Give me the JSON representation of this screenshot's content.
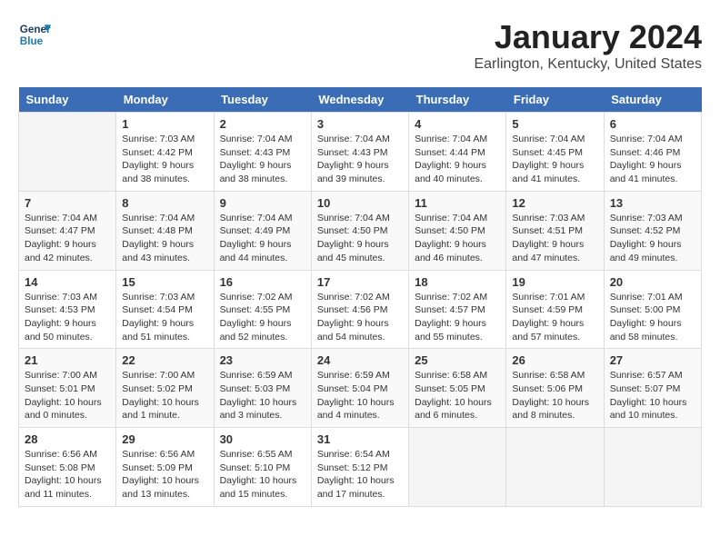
{
  "logo": {
    "line1": "General",
    "line2": "Blue"
  },
  "title": "January 2024",
  "subtitle": "Earlington, Kentucky, United States",
  "days_of_week": [
    "Sunday",
    "Monday",
    "Tuesday",
    "Wednesday",
    "Thursday",
    "Friday",
    "Saturday"
  ],
  "weeks": [
    [
      {
        "num": "",
        "info": ""
      },
      {
        "num": "1",
        "info": "Sunrise: 7:03 AM\nSunset: 4:42 PM\nDaylight: 9 hours\nand 38 minutes."
      },
      {
        "num": "2",
        "info": "Sunrise: 7:04 AM\nSunset: 4:43 PM\nDaylight: 9 hours\nand 38 minutes."
      },
      {
        "num": "3",
        "info": "Sunrise: 7:04 AM\nSunset: 4:43 PM\nDaylight: 9 hours\nand 39 minutes."
      },
      {
        "num": "4",
        "info": "Sunrise: 7:04 AM\nSunset: 4:44 PM\nDaylight: 9 hours\nand 40 minutes."
      },
      {
        "num": "5",
        "info": "Sunrise: 7:04 AM\nSunset: 4:45 PM\nDaylight: 9 hours\nand 41 minutes."
      },
      {
        "num": "6",
        "info": "Sunrise: 7:04 AM\nSunset: 4:46 PM\nDaylight: 9 hours\nand 41 minutes."
      }
    ],
    [
      {
        "num": "7",
        "info": "Sunrise: 7:04 AM\nSunset: 4:47 PM\nDaylight: 9 hours\nand 42 minutes."
      },
      {
        "num": "8",
        "info": "Sunrise: 7:04 AM\nSunset: 4:48 PM\nDaylight: 9 hours\nand 43 minutes."
      },
      {
        "num": "9",
        "info": "Sunrise: 7:04 AM\nSunset: 4:49 PM\nDaylight: 9 hours\nand 44 minutes."
      },
      {
        "num": "10",
        "info": "Sunrise: 7:04 AM\nSunset: 4:50 PM\nDaylight: 9 hours\nand 45 minutes."
      },
      {
        "num": "11",
        "info": "Sunrise: 7:04 AM\nSunset: 4:50 PM\nDaylight: 9 hours\nand 46 minutes."
      },
      {
        "num": "12",
        "info": "Sunrise: 7:03 AM\nSunset: 4:51 PM\nDaylight: 9 hours\nand 47 minutes."
      },
      {
        "num": "13",
        "info": "Sunrise: 7:03 AM\nSunset: 4:52 PM\nDaylight: 9 hours\nand 49 minutes."
      }
    ],
    [
      {
        "num": "14",
        "info": "Sunrise: 7:03 AM\nSunset: 4:53 PM\nDaylight: 9 hours\nand 50 minutes."
      },
      {
        "num": "15",
        "info": "Sunrise: 7:03 AM\nSunset: 4:54 PM\nDaylight: 9 hours\nand 51 minutes."
      },
      {
        "num": "16",
        "info": "Sunrise: 7:02 AM\nSunset: 4:55 PM\nDaylight: 9 hours\nand 52 minutes."
      },
      {
        "num": "17",
        "info": "Sunrise: 7:02 AM\nSunset: 4:56 PM\nDaylight: 9 hours\nand 54 minutes."
      },
      {
        "num": "18",
        "info": "Sunrise: 7:02 AM\nSunset: 4:57 PM\nDaylight: 9 hours\nand 55 minutes."
      },
      {
        "num": "19",
        "info": "Sunrise: 7:01 AM\nSunset: 4:59 PM\nDaylight: 9 hours\nand 57 minutes."
      },
      {
        "num": "20",
        "info": "Sunrise: 7:01 AM\nSunset: 5:00 PM\nDaylight: 9 hours\nand 58 minutes."
      }
    ],
    [
      {
        "num": "21",
        "info": "Sunrise: 7:00 AM\nSunset: 5:01 PM\nDaylight: 10 hours\nand 0 minutes."
      },
      {
        "num": "22",
        "info": "Sunrise: 7:00 AM\nSunset: 5:02 PM\nDaylight: 10 hours\nand 1 minute."
      },
      {
        "num": "23",
        "info": "Sunrise: 6:59 AM\nSunset: 5:03 PM\nDaylight: 10 hours\nand 3 minutes."
      },
      {
        "num": "24",
        "info": "Sunrise: 6:59 AM\nSunset: 5:04 PM\nDaylight: 10 hours\nand 4 minutes."
      },
      {
        "num": "25",
        "info": "Sunrise: 6:58 AM\nSunset: 5:05 PM\nDaylight: 10 hours\nand 6 minutes."
      },
      {
        "num": "26",
        "info": "Sunrise: 6:58 AM\nSunset: 5:06 PM\nDaylight: 10 hours\nand 8 minutes."
      },
      {
        "num": "27",
        "info": "Sunrise: 6:57 AM\nSunset: 5:07 PM\nDaylight: 10 hours\nand 10 minutes."
      }
    ],
    [
      {
        "num": "28",
        "info": "Sunrise: 6:56 AM\nSunset: 5:08 PM\nDaylight: 10 hours\nand 11 minutes."
      },
      {
        "num": "29",
        "info": "Sunrise: 6:56 AM\nSunset: 5:09 PM\nDaylight: 10 hours\nand 13 minutes."
      },
      {
        "num": "30",
        "info": "Sunrise: 6:55 AM\nSunset: 5:10 PM\nDaylight: 10 hours\nand 15 minutes."
      },
      {
        "num": "31",
        "info": "Sunrise: 6:54 AM\nSunset: 5:12 PM\nDaylight: 10 hours\nand 17 minutes."
      },
      {
        "num": "",
        "info": ""
      },
      {
        "num": "",
        "info": ""
      },
      {
        "num": "",
        "info": ""
      }
    ]
  ]
}
